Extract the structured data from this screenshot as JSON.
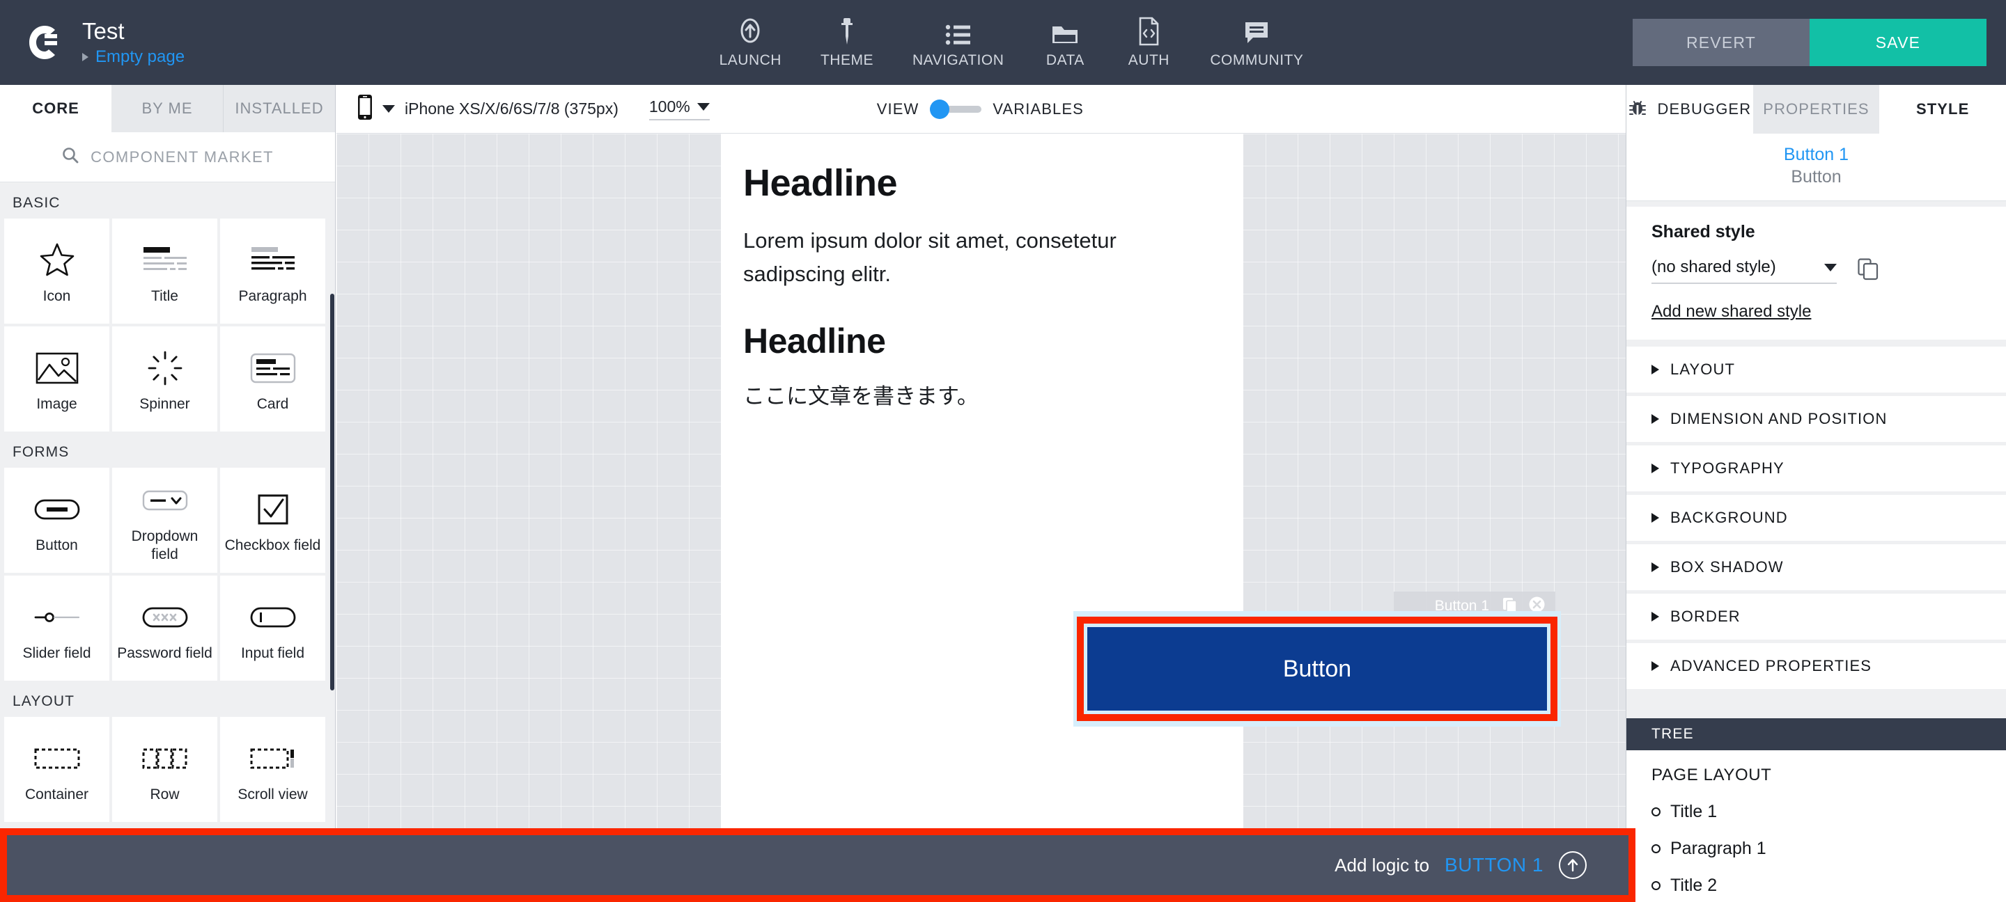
{
  "topbar": {
    "logo": "gc-logo-icon",
    "project_title": "Test",
    "page_name": "Empty page",
    "nav": [
      {
        "label": "LAUNCH",
        "icon": "launch-rocket-icon"
      },
      {
        "label": "THEME",
        "icon": "eyedropper-icon"
      },
      {
        "label": "NAVIGATION",
        "icon": "list-icon"
      },
      {
        "label": "DATA",
        "icon": "folder-icon"
      },
      {
        "label": "AUTH",
        "icon": "file-code-icon"
      },
      {
        "label": "COMMUNITY",
        "icon": "chat-bubble-icon"
      }
    ],
    "revert_label": "REVERT",
    "save_label": "SAVE"
  },
  "left_panel": {
    "tabs": [
      {
        "label": "CORE",
        "active": true
      },
      {
        "label": "BY ME",
        "active": false
      },
      {
        "label": "INSTALLED",
        "active": false
      }
    ],
    "search_placeholder": "COMPONENT MARKET",
    "search_icon": "search-icon",
    "sections": [
      {
        "label": "BASIC",
        "items": [
          {
            "label": "Icon",
            "icon": "star-icon"
          },
          {
            "label": "Title",
            "icon": "title-lines-icon"
          },
          {
            "label": "Paragraph",
            "icon": "paragraph-lines-icon"
          },
          {
            "label": "Image",
            "icon": "image-icon"
          },
          {
            "label": "Spinner",
            "icon": "spinner-icon"
          },
          {
            "label": "Card",
            "icon": "card-icon"
          }
        ]
      },
      {
        "label": "FORMS",
        "items": [
          {
            "label": "Button",
            "icon": "button-pill-icon"
          },
          {
            "label": "Dropdown field",
            "icon": "dropdown-icon"
          },
          {
            "label": "Checkbox field",
            "icon": "checkbox-icon"
          },
          {
            "label": "Slider field",
            "icon": "slider-icon"
          },
          {
            "label": "Password field",
            "icon": "password-icon"
          },
          {
            "label": "Input field",
            "icon": "input-icon"
          }
        ]
      },
      {
        "label": "LAYOUT",
        "items": [
          {
            "label": "Container",
            "icon": "container-dashed-icon"
          },
          {
            "label": "Row",
            "icon": "row-dashed-icon"
          },
          {
            "label": "Scroll view",
            "icon": "scrollview-dashed-icon"
          }
        ]
      }
    ]
  },
  "canvas_toolbar": {
    "device_icon": "phone-icon",
    "device_label": "iPhone XS/X/6/6S/7/8 (375px)",
    "zoom_label": "100%",
    "view_label": "VIEW",
    "variables_label": "VARIABLES",
    "toggle_position": "view"
  },
  "right_tabs": [
    {
      "label": "DEBUGGER",
      "icon": "bug-icon",
      "active": false,
      "white": true
    },
    {
      "label": "PROPERTIES",
      "icon": "",
      "active": false,
      "white": false
    },
    {
      "label": "STYLE",
      "icon": "",
      "active": true,
      "white": true
    }
  ],
  "canvas": {
    "headline_1": "Headline",
    "paragraph_1": "Lorem ipsum dolor sit amet, consetetur sadipscing elitr.",
    "headline_2": "Headline",
    "paragraph_2": "ここに文章を書きます。",
    "button_label": "Button",
    "button_color": "#0c3c91",
    "selection_badge_name": "Button 1",
    "selection_badge_icons": [
      "duplicate-icon",
      "close-icon"
    ],
    "selection_highlight_color": "#fa2600"
  },
  "style_panel": {
    "selected_name": "Button 1",
    "selected_type": "Button",
    "shared_style_title": "Shared style",
    "shared_style_value": "(no shared style)",
    "copy_icon": "duplicate-icon",
    "add_shared_style_link": "Add new shared style",
    "accordions": [
      "LAYOUT",
      "DIMENSION AND POSITION",
      "TYPOGRAPHY",
      "BACKGROUND",
      "BOX SHADOW",
      "BORDER",
      "ADVANCED PROPERTIES"
    ]
  },
  "tree": {
    "header": "TREE",
    "root": "PAGE LAYOUT",
    "nodes": [
      {
        "label": "Title 1"
      },
      {
        "label": "Paragraph 1"
      },
      {
        "label": "Title 2"
      }
    ]
  },
  "bottombar": {
    "prefix": "Add logic to",
    "target": "BUTTON 1",
    "icon": "arrow-up-circle-icon",
    "accent_color": "#2196f3",
    "highlight_color": "#fa2600"
  }
}
